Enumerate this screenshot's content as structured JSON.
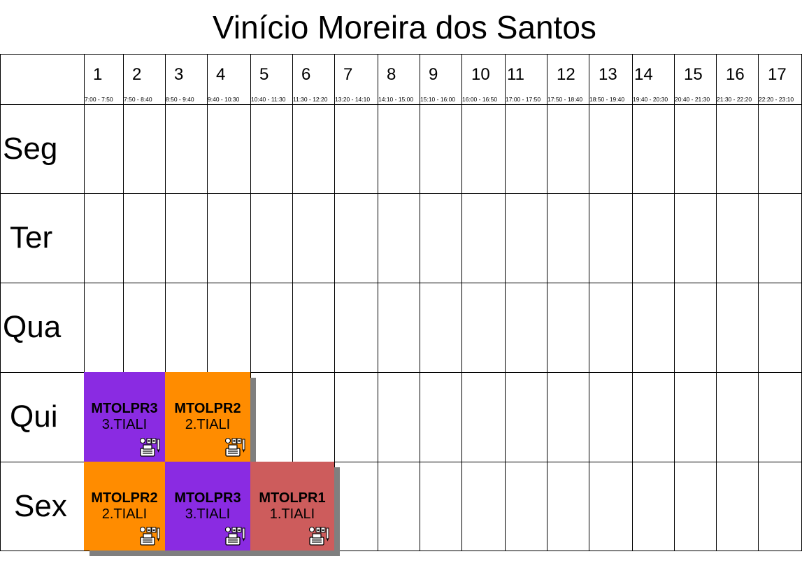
{
  "title": "Vinício Moreira dos Santos",
  "slots": [
    {
      "num": "1",
      "time": "7:00 - 7:50"
    },
    {
      "num": "2",
      "time": "7:50 - 8:40"
    },
    {
      "num": "3",
      "time": "8:50 - 9:40"
    },
    {
      "num": "4",
      "time": "9:40 - 10:30"
    },
    {
      "num": "5",
      "time": "10:40 - 11:30"
    },
    {
      "num": "6",
      "time": "11:30 - 12:20"
    },
    {
      "num": "7",
      "time": "13:20 - 14:10"
    },
    {
      "num": "8",
      "time": "14:10 - 15:00"
    },
    {
      "num": "9",
      "time": "15:10 - 16:00"
    },
    {
      "num": "10",
      "time": "16:00 - 16:50"
    },
    {
      "num": "11",
      "time": "17:00 - 17:50"
    },
    {
      "num": "12",
      "time": "17:50 - 18:40"
    },
    {
      "num": "13",
      "time": "18:50 - 19:40"
    },
    {
      "num": "14",
      "time": "19:40 - 20:30"
    },
    {
      "num": "15",
      "time": "20:40 - 21:30"
    },
    {
      "num": "16",
      "time": "21:30 - 22:20"
    },
    {
      "num": "17",
      "time": "22:20 - 23:10"
    }
  ],
  "days": [
    "Seg",
    "Ter",
    "Qua",
    "Qui",
    "Sex"
  ],
  "colors": {
    "purple": "#8a2be2",
    "orange": "#ff8c00",
    "red": "#cd5c5c",
    "shadow": "#7f7f7f"
  },
  "lessons": [
    {
      "day": 3,
      "start": 1,
      "span": 2,
      "code": "MTOLPR3",
      "class": "3.TIALI",
      "color": "#8a2be2",
      "icon": "typewriter-icon"
    },
    {
      "day": 3,
      "start": 3,
      "span": 2,
      "code": "MTOLPR2",
      "class": "2.TIALI",
      "color": "#ff8c00",
      "icon": "typewriter-icon"
    },
    {
      "day": 4,
      "start": 1,
      "span": 2,
      "code": "MTOLPR2",
      "class": "2.TIALI",
      "color": "#ff8c00",
      "icon": "typewriter-icon"
    },
    {
      "day": 4,
      "start": 3,
      "span": 2,
      "code": "MTOLPR3",
      "class": "3.TIALI",
      "color": "#8a2be2",
      "icon": "typewriter-icon"
    },
    {
      "day": 4,
      "start": 5,
      "span": 2,
      "code": "MTOLPR1",
      "class": "1.TIALI",
      "color": "#cd5c5c",
      "icon": "typewriter-icon"
    }
  ]
}
